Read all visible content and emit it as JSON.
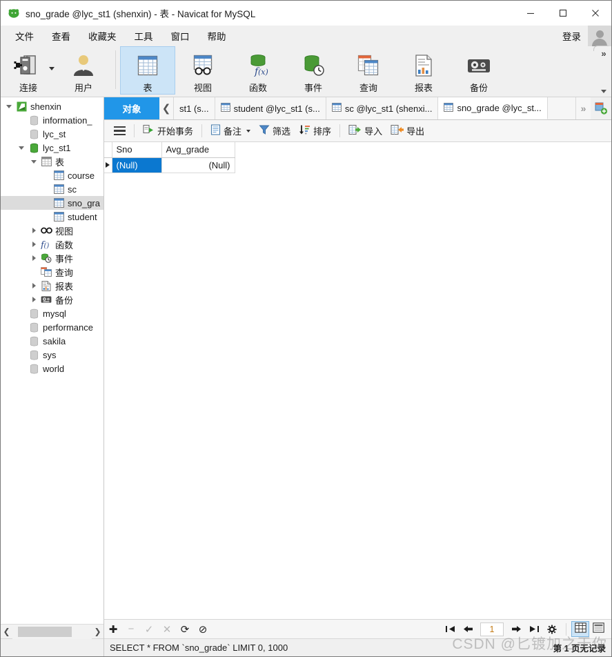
{
  "window": {
    "title": "sno_grade @lyc_st1 (shenxin) - 表 - Navicat for MySQL",
    "app_icon": "navicat-logo-icon",
    "minimize": "−",
    "maximize": "□",
    "close": "✕"
  },
  "menubar": {
    "items": [
      {
        "label": "文件",
        "name": "menu-file"
      },
      {
        "label": "查看",
        "name": "menu-view"
      },
      {
        "label": "收藏夹",
        "name": "menu-favorites"
      },
      {
        "label": "工具",
        "name": "menu-tools"
      },
      {
        "label": "窗口",
        "name": "menu-window"
      },
      {
        "label": "帮助",
        "name": "menu-help"
      }
    ],
    "login_label": "登录"
  },
  "toolbar": {
    "buttons": [
      {
        "label": "连接",
        "icon": "connection-icon",
        "selected": false,
        "has_caret": true
      },
      {
        "label": "用户",
        "icon": "user-icon",
        "selected": false,
        "has_caret": false
      },
      {
        "label": "表",
        "icon": "table-icon",
        "selected": true,
        "has_caret": false
      },
      {
        "label": "视图",
        "icon": "view-icon",
        "selected": false,
        "has_caret": false
      },
      {
        "label": "函数",
        "icon": "function-icon",
        "selected": false,
        "has_caret": false
      },
      {
        "label": "事件",
        "icon": "event-icon",
        "selected": false,
        "has_caret": false
      },
      {
        "label": "查询",
        "icon": "query-icon",
        "selected": false,
        "has_caret": false
      },
      {
        "label": "报表",
        "icon": "report-icon",
        "selected": false,
        "has_caret": false
      },
      {
        "label": "备份",
        "icon": "backup-icon",
        "selected": false,
        "has_caret": false
      }
    ],
    "overflow_glyph": "»"
  },
  "sidebar": {
    "tree": [
      {
        "label": "shenxin",
        "indent": 0,
        "icon": "connection-green-icon",
        "state": "open",
        "selected": false
      },
      {
        "label": "information_",
        "indent": 1,
        "icon": "database-gray-icon",
        "state": "leaf",
        "selected": false
      },
      {
        "label": "lyc_st",
        "indent": 1,
        "icon": "database-gray-icon",
        "state": "leaf",
        "selected": false
      },
      {
        "label": "lyc_st1",
        "indent": 1,
        "icon": "database-green-icon",
        "state": "open",
        "selected": false
      },
      {
        "label": "表",
        "indent": 2,
        "icon": "table-folder-icon",
        "state": "open",
        "selected": false
      },
      {
        "label": "course",
        "indent": 3,
        "icon": "table-icon",
        "state": "leaf",
        "selected": false
      },
      {
        "label": "sc",
        "indent": 3,
        "icon": "table-icon",
        "state": "leaf",
        "selected": false
      },
      {
        "label": "sno_gra",
        "indent": 3,
        "icon": "table-icon",
        "state": "leaf",
        "selected": true
      },
      {
        "label": "student",
        "indent": 3,
        "icon": "table-icon",
        "state": "leaf",
        "selected": false
      },
      {
        "label": "视图",
        "indent": 2,
        "icon": "view-glasses-icon",
        "state": "closed",
        "selected": false
      },
      {
        "label": "函数",
        "indent": 2,
        "icon": "function-fx-icon",
        "state": "closed",
        "selected": false
      },
      {
        "label": "事件",
        "indent": 2,
        "icon": "event-clock-icon",
        "state": "closed",
        "selected": false
      },
      {
        "label": "查询",
        "indent": 2,
        "icon": "query-icon",
        "state": "leaf",
        "selected": false
      },
      {
        "label": "报表",
        "indent": 2,
        "icon": "report-icon",
        "state": "closed",
        "selected": false
      },
      {
        "label": "备份",
        "indent": 2,
        "icon": "backup-icon",
        "state": "closed",
        "selected": false
      },
      {
        "label": "mysql",
        "indent": 1,
        "icon": "database-gray-icon",
        "state": "leaf",
        "selected": false
      },
      {
        "label": "performance",
        "indent": 1,
        "icon": "database-gray-icon",
        "state": "leaf",
        "selected": false
      },
      {
        "label": "sakila",
        "indent": 1,
        "icon": "database-gray-icon",
        "state": "leaf",
        "selected": false
      },
      {
        "label": "sys",
        "indent": 1,
        "icon": "database-gray-icon",
        "state": "leaf",
        "selected": false
      },
      {
        "label": "world",
        "indent": 1,
        "icon": "database-gray-icon",
        "state": "leaf",
        "selected": false
      }
    ],
    "scroll_left": "❮",
    "scroll_right": "❯"
  },
  "tabstrip": {
    "object_tab": "对象",
    "scroll_left_glyph": "❮",
    "tabs": [
      {
        "label": "st1 (s...",
        "icon": "table-icon",
        "active": false,
        "truncated_left": true
      },
      {
        "label": "student @lyc_st1 (s...",
        "icon": "table-icon",
        "active": false
      },
      {
        "label": "sc @lyc_st1 (shenxi...",
        "icon": "table-icon",
        "active": false
      },
      {
        "label": "sno_grade @lyc_st...",
        "icon": "table-icon",
        "active": true
      }
    ],
    "more_glyph": "»",
    "new_tab_icon": "new-tab-plus-icon"
  },
  "datatoolbar": {
    "menu_icon": "hamburger-menu-icon",
    "buttons": [
      {
        "label": "开始事务",
        "icon": "begin-transaction-icon",
        "caret": false
      },
      {
        "label": "备注",
        "icon": "note-icon",
        "caret": true
      },
      {
        "label": "筛选",
        "icon": "filter-icon",
        "caret": false
      },
      {
        "label": "排序",
        "icon": "sort-icon",
        "caret": false
      },
      {
        "label": "导入",
        "icon": "import-icon",
        "caret": false
      },
      {
        "label": "导出",
        "icon": "export-icon",
        "caret": false
      }
    ]
  },
  "grid": {
    "columns": [
      "Sno",
      "Avg_grade"
    ],
    "rows": [
      {
        "selected_row": true,
        "cells": [
          "(Null)",
          "(Null)"
        ]
      }
    ],
    "selected_cell_index": 0
  },
  "bottombar": {
    "actions": [
      {
        "name": "add-record-button",
        "glyph": "✚",
        "enabled": true
      },
      {
        "name": "remove-record-button",
        "glyph": "−",
        "enabled": false
      },
      {
        "name": "apply-change-button",
        "glyph": "✓",
        "enabled": false
      },
      {
        "name": "cancel-change-button",
        "glyph": "✕",
        "enabled": false
      },
      {
        "name": "refresh-button",
        "glyph": "⟳",
        "enabled": true
      },
      {
        "name": "stop-button",
        "glyph": "⊘",
        "enabled": true
      }
    ],
    "nav": {
      "first": "first-page-icon",
      "prev": "prev-page-icon",
      "page_value": "1",
      "next": "next-page-icon",
      "last": "last-page-icon",
      "settings": "gear-icon"
    },
    "view_modes": [
      {
        "name": "grid-view-toggle",
        "icon": "grid-view-icon",
        "active": true
      },
      {
        "name": "form-view-toggle",
        "icon": "form-view-icon",
        "active": false
      }
    ]
  },
  "statusbar": {
    "sql": "SELECT * FROM `sno_grade` LIMIT 0, 1000",
    "page_status": "第 1 页无记录"
  },
  "watermark": "CSDN @匕镀加之于你",
  "colors": {
    "accent_blue": "#2196e8",
    "selection_blue": "#0b78d0",
    "ribbon_selected": "#cce4f7",
    "panel_gray": "#f0f0f0"
  }
}
